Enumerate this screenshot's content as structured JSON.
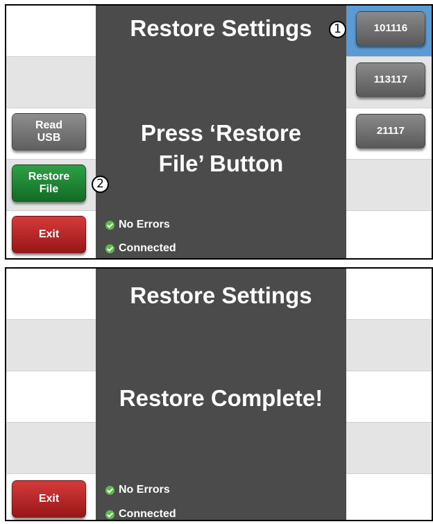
{
  "screen1": {
    "title": "Restore Settings",
    "message_line1": "Press ‘Restore",
    "message_line2": "File’ Button",
    "buttons": {
      "read_usb": "Read\nUSB",
      "restore_file": "Restore\nFile",
      "exit": "Exit"
    },
    "files": [
      "101116",
      "113117",
      "21117"
    ],
    "status": [
      "No Errors",
      "Connected"
    ],
    "callouts": [
      "1",
      "2"
    ]
  },
  "screen2": {
    "title": "Restore Settings",
    "message": "Restore Complete!",
    "buttons": {
      "exit": "Exit"
    },
    "status": [
      "No Errors",
      "Connected"
    ]
  },
  "colors": {
    "panel": "#4b4b4b",
    "row_grey": "#e4e4e4",
    "selected_row": "#5b9bd5",
    "button_grey": "#707070",
    "button_green": "#1f8a35",
    "button_red": "#b72626",
    "status_ok": "#5dbb4a"
  },
  "icons": [
    "check-icon",
    "callout-1",
    "callout-2"
  ]
}
